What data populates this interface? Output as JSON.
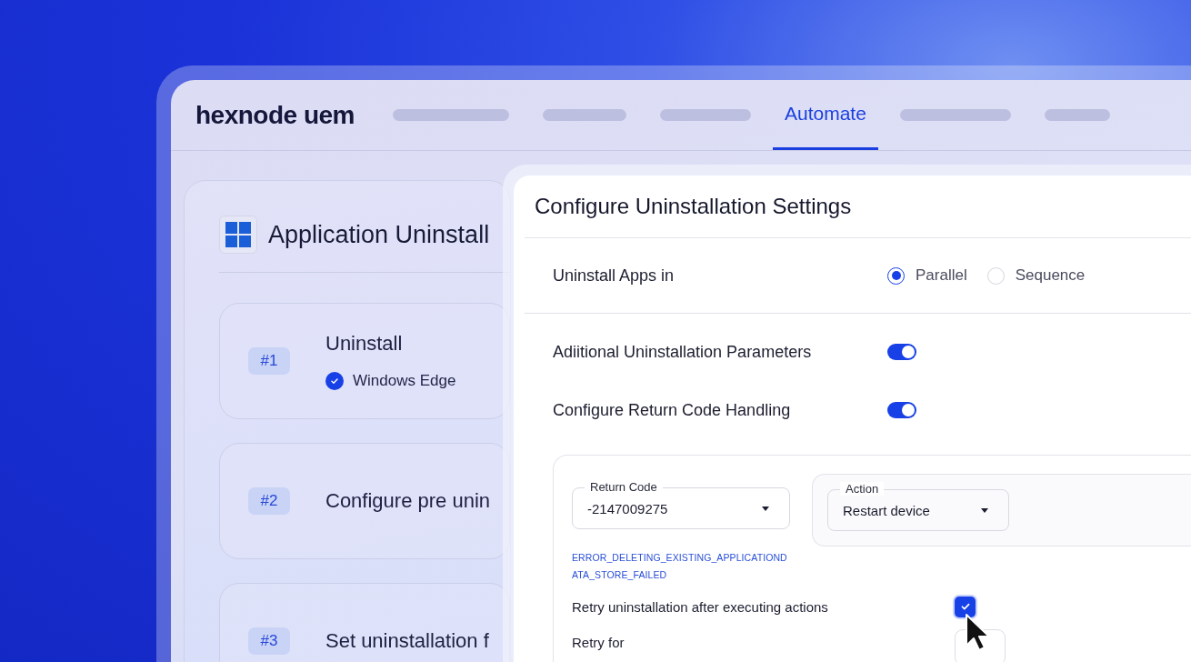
{
  "brand": {
    "logo": "hexnode uem"
  },
  "nav_tabs": [
    {
      "kind": "placeholder",
      "selected": false
    },
    {
      "kind": "placeholder",
      "selected": false
    },
    {
      "kind": "placeholder",
      "selected": false
    },
    {
      "kind": "label",
      "label": "Automate",
      "selected": true
    },
    {
      "kind": "placeholder",
      "selected": false
    },
    {
      "kind": "placeholder",
      "selected": false
    }
  ],
  "policy": {
    "title": "Application Uninstall",
    "steps": [
      {
        "number": "#1",
        "title": "Uninstall",
        "apps": [
          {
            "name": "Windows Edge",
            "checked": true
          }
        ]
      },
      {
        "number": "#2",
        "title": "Configure pre unin"
      },
      {
        "number": "#3",
        "title": "Set uninstallation f"
      }
    ]
  },
  "dialog": {
    "title": "Configure Uninstallation Settings",
    "uninstall_mode": {
      "label": "Uninstall Apps in",
      "options": [
        {
          "label": "Parallel",
          "selected": true
        },
        {
          "label": "Sequence",
          "selected": false
        }
      ]
    },
    "toggles": [
      {
        "label": "Adiitional Uninstallation Parameters",
        "on": true
      },
      {
        "label": "Configure Return Code Handling",
        "on": true
      }
    ],
    "return_code_rule": {
      "return_code": {
        "label": "Return Code",
        "value": "-2147009275"
      },
      "code_name_lines": [
        "ERROR_DELETING_EXISTING_APPLICATIOND",
        "ATA_STORE_FAILED"
      ],
      "action": {
        "label": "Action",
        "value": "Restart device"
      }
    },
    "retry": {
      "label": "Retry uninstallation after executing actions",
      "checked": true
    },
    "retry_for": {
      "label": "Retry for"
    }
  }
}
